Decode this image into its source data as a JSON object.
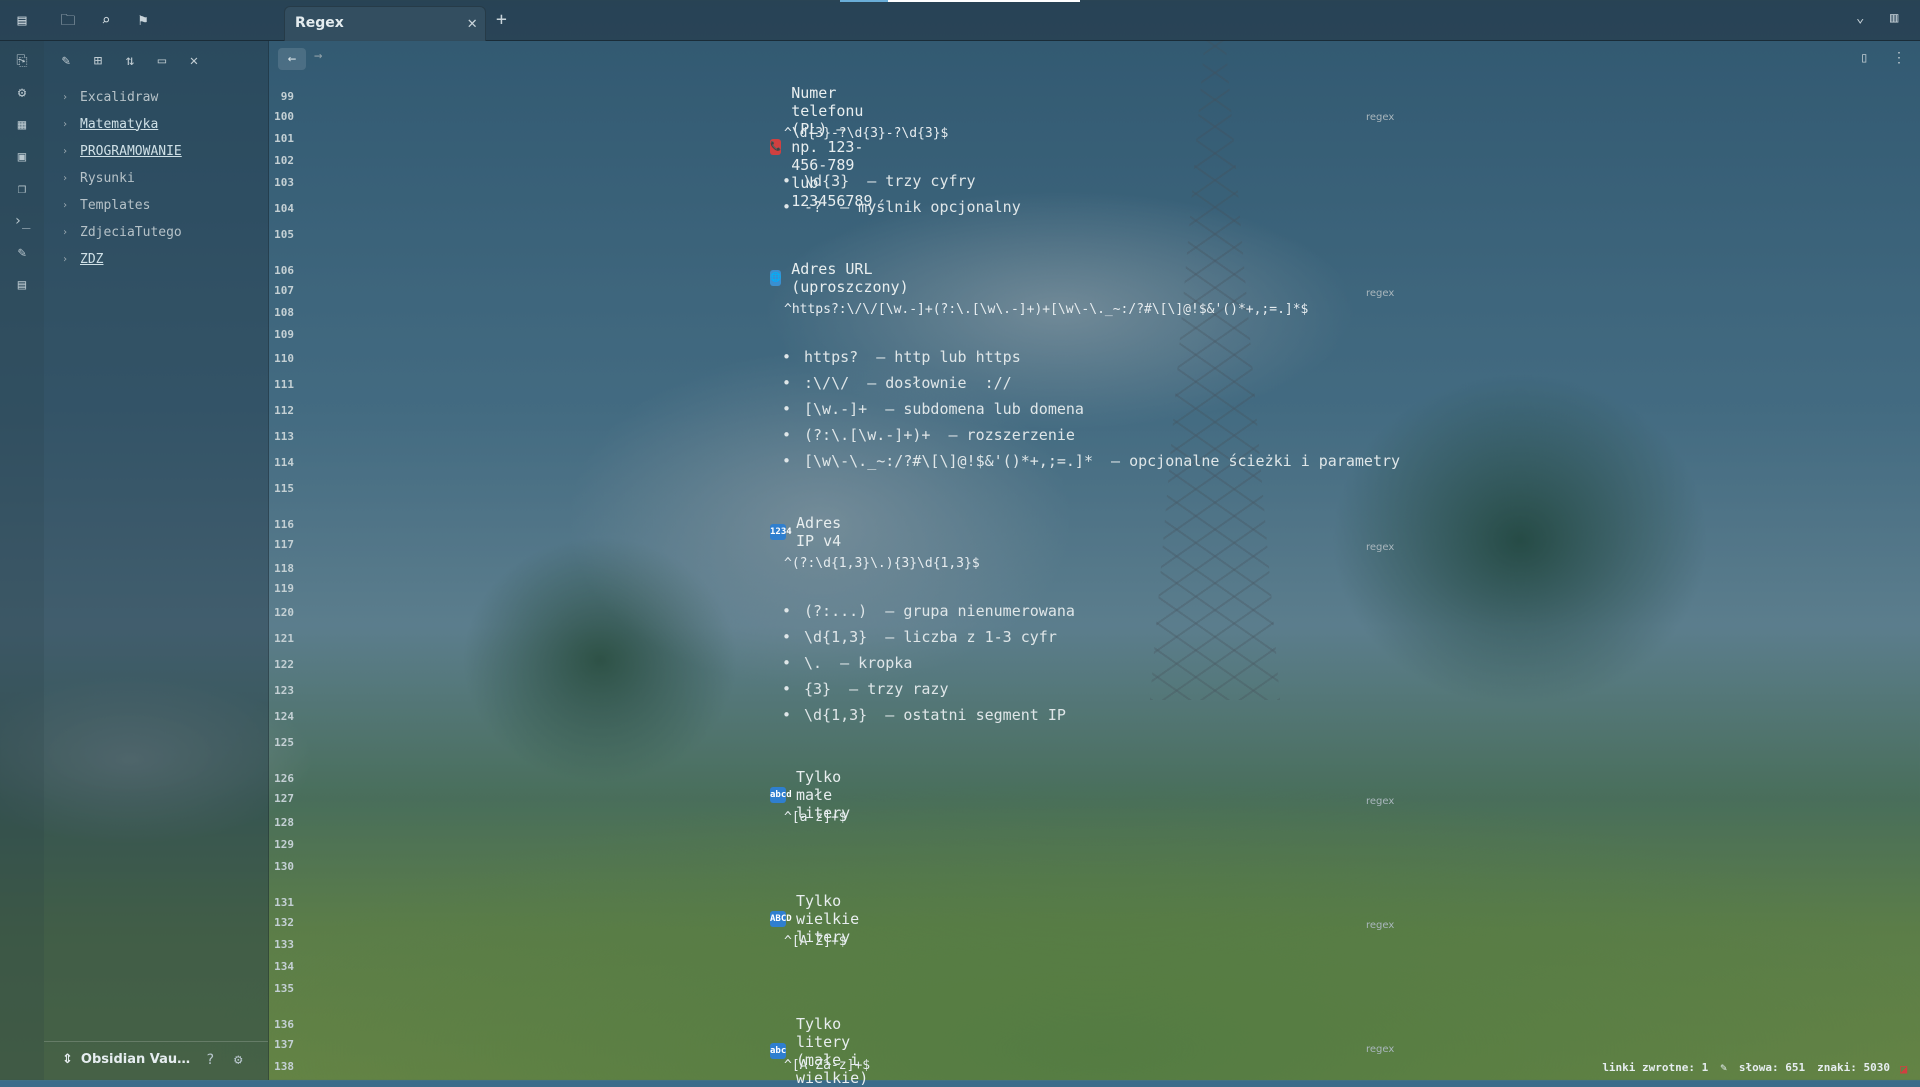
{
  "app": {
    "tab_title": "Regex",
    "tab_close": "✕",
    "tab_add": "+"
  },
  "sidebar": {
    "items": [
      {
        "label": "Excalidraw",
        "linked": false
      },
      {
        "label": "Matematyka",
        "linked": true
      },
      {
        "label": "PROGRAMOWANIE",
        "linked": true
      },
      {
        "label": "Rysunki",
        "linked": false
      },
      {
        "label": "Templates",
        "linked": false
      },
      {
        "label": "ZdjeciaTutego",
        "linked": false
      },
      {
        "label": "ZDZ",
        "linked": true
      }
    ],
    "vault_name": "Obsidian Vau…"
  },
  "line_numbers": [
    "99",
    "100",
    "101",
    "102",
    "103",
    "104",
    "105",
    "106",
    "107",
    "108",
    "109",
    "110",
    "111",
    "112",
    "113",
    "114",
    "115",
    "116",
    "117",
    "118",
    "119",
    "120",
    "121",
    "122",
    "123",
    "124",
    "125",
    "126",
    "127",
    "128",
    "129",
    "130",
    "131",
    "132",
    "133",
    "134",
    "135",
    "136",
    "137",
    "138"
  ],
  "sections": [
    {
      "icon": "phone-icon",
      "icon_glyph": "📞",
      "icon_color": "#d04040",
      "title": "Numer telefonu (PL) – np. 123-456-789 lub 123456789",
      "code": "^\\d{3}-?\\d{3}-?\\d{3}$",
      "lang": "regex",
      "bullets": [
        "\\d{3}  – trzy cyfry",
        "-?  – myślnik opcjonalny"
      ]
    },
    {
      "icon": "globe-icon",
      "icon_glyph": "🌐",
      "icon_color": "#3a8fd0",
      "title": "Adres URL (uproszczony)",
      "code": "^https?:\\/\\/[\\w.-]+(?:\\.[\\w\\.-]+)+[\\w\\-\\._~:/?#\\[\\]@!$&'()*+,;=.]*$",
      "lang": "regex",
      "bullets": [
        "https?  – http lub https",
        ":\\/\\/  – dosłownie  ://",
        "[\\w.-]+  – subdomena lub domena",
        "(?:\\.[\\w.-]+)+  – rozszerzenie",
        "[\\w\\-\\._~:/?#\\[\\]@!$&'()*+,;=.]*  – opcjonalne ścieżki i parametry"
      ]
    },
    {
      "icon": "numbers-icon",
      "icon_glyph": "1234",
      "icon_color": "#2f7fcf",
      "title": "Adres IP v4",
      "code": "^(?:\\d{1,3}\\.){3}\\d{1,3}$",
      "lang": "regex",
      "bullets": [
        "(?:...)  – grupa nienumerowana",
        "\\d{1,3}  – liczba z 1-3 cyfr",
        "\\.  – kropka",
        "{3}  – trzy razy",
        "\\d{1,3}  – ostatni segment IP"
      ]
    },
    {
      "icon": "lowercase-icon",
      "icon_glyph": "abcd",
      "icon_color": "#2f7fcf",
      "title": "Tylko małe litery",
      "code": "^[a-z]+$",
      "lang": "regex",
      "bullets": []
    },
    {
      "icon": "uppercase-icon",
      "icon_glyph": "ABCD",
      "icon_color": "#2f7fcf",
      "title": "Tylko wielkie litery",
      "code": "^[A-Z]+$",
      "lang": "regex",
      "bullets": []
    },
    {
      "icon": "letters-icon",
      "icon_glyph": "abc",
      "icon_color": "#2f7fcf",
      "title": "Tylko litery (małe i wielkie)",
      "code": "^[A-Za-z]+$",
      "lang": "regex",
      "bullets": []
    }
  ],
  "status": {
    "backlinks": "linki zwrotne: 1",
    "words": "słowa: 651",
    "chars": "znaki: 5030"
  }
}
